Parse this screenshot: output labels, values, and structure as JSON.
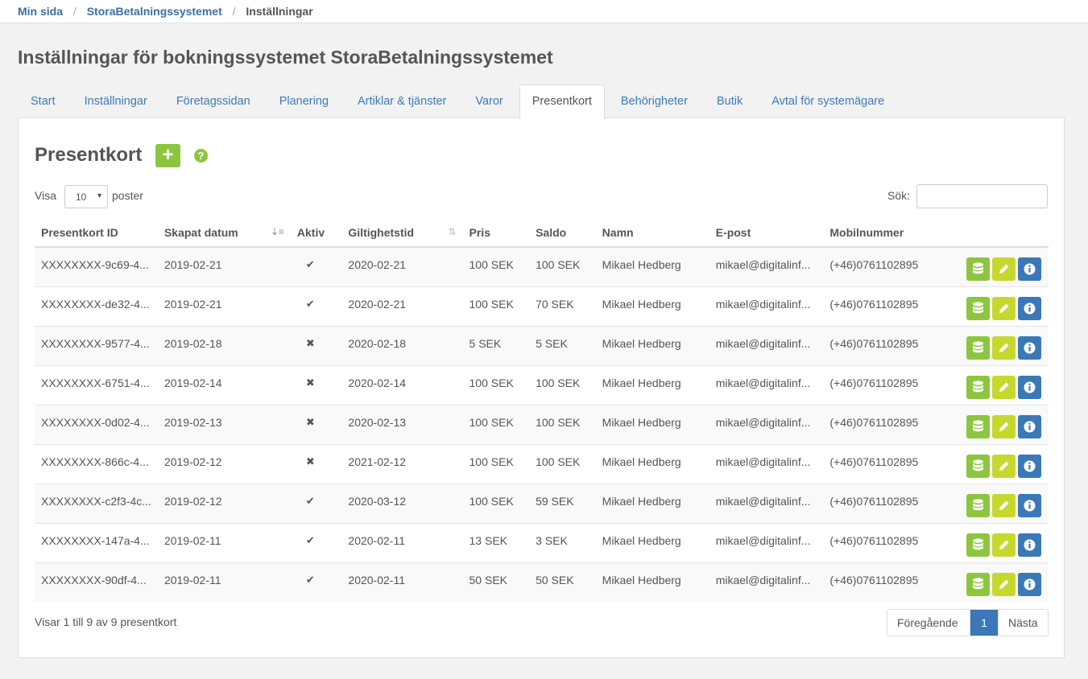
{
  "breadcrumb": {
    "items": [
      "Min sida",
      "StoraBetalningssystemet"
    ],
    "current": "Inställningar"
  },
  "page_title": "Inställningar för bokningssystemet StoraBetalningssystemet",
  "tabs": [
    {
      "label": "Start",
      "active": false
    },
    {
      "label": "Inställningar",
      "active": false
    },
    {
      "label": "Företagssidan",
      "active": false
    },
    {
      "label": "Planering",
      "active": false
    },
    {
      "label": "Artiklar & tjänster",
      "active": false
    },
    {
      "label": "Varor",
      "active": false
    },
    {
      "label": "Presentkort",
      "active": true
    },
    {
      "label": "Behörigheter",
      "active": false
    },
    {
      "label": "Butik",
      "active": false
    },
    {
      "label": "Avtal för systemägare",
      "active": false
    }
  ],
  "section": {
    "title": "Presentkort",
    "add_label": "+",
    "help_label": "?"
  },
  "controls": {
    "show_label": "Visa",
    "page_size": "10",
    "show_suffix": "poster",
    "search_label": "Sök:",
    "search_value": ""
  },
  "table": {
    "headers": [
      "Presentkort ID",
      "Skapat datum",
      "Aktiv",
      "Giltighetstid",
      "Pris",
      "Saldo",
      "Namn",
      "E-post",
      "Mobilnummer"
    ],
    "rows": [
      {
        "id": "XXXXXXXX-9c69-4...",
        "created": "2019-02-21",
        "active": true,
        "valid": "2020-02-21",
        "price": "100 SEK",
        "balance": "100 SEK",
        "name": "Mikael Hedberg",
        "email": "mikael@digitalinf...",
        "phone": "(+46)0761102895"
      },
      {
        "id": "XXXXXXXX-de32-4...",
        "created": "2019-02-21",
        "active": true,
        "valid": "2020-02-21",
        "price": "100 SEK",
        "balance": "70 SEK",
        "name": "Mikael Hedberg",
        "email": "mikael@digitalinf...",
        "phone": "(+46)0761102895"
      },
      {
        "id": "XXXXXXXX-9577-4...",
        "created": "2019-02-18",
        "active": false,
        "valid": "2020-02-18",
        "price": "5 SEK",
        "balance": "5 SEK",
        "name": "Mikael Hedberg",
        "email": "mikael@digitalinf...",
        "phone": "(+46)0761102895"
      },
      {
        "id": "XXXXXXXX-6751-4...",
        "created": "2019-02-14",
        "active": false,
        "valid": "2020-02-14",
        "price": "100 SEK",
        "balance": "100 SEK",
        "name": "Mikael Hedberg",
        "email": "mikael@digitalinf...",
        "phone": "(+46)0761102895"
      },
      {
        "id": "XXXXXXXX-0d02-4...",
        "created": "2019-02-13",
        "active": false,
        "valid": "2020-02-13",
        "price": "100 SEK",
        "balance": "100 SEK",
        "name": "Mikael Hedberg",
        "email": "mikael@digitalinf...",
        "phone": "(+46)0761102895"
      },
      {
        "id": "XXXXXXXX-866c-4...",
        "created": "2019-02-12",
        "active": false,
        "valid": "2021-02-12",
        "price": "100 SEK",
        "balance": "100 SEK",
        "name": "Mikael Hedberg",
        "email": "mikael@digitalinf...",
        "phone": "(+46)0761102895"
      },
      {
        "id": "XXXXXXXX-c2f3-4c...",
        "created": "2019-02-12",
        "active": true,
        "valid": "2020-03-12",
        "price": "100 SEK",
        "balance": "59 SEK",
        "name": "Mikael Hedberg",
        "email": "mikael@digitalinf...",
        "phone": "(+46)0761102895"
      },
      {
        "id": "XXXXXXXX-147a-4...",
        "created": "2019-02-11",
        "active": true,
        "valid": "2020-02-11",
        "price": "13 SEK",
        "balance": "3 SEK",
        "name": "Mikael Hedberg",
        "email": "mikael@digitalinf...",
        "phone": "(+46)0761102895"
      },
      {
        "id": "XXXXXXXX-90df-4...",
        "created": "2019-02-11",
        "active": true,
        "valid": "2020-02-11",
        "price": "50 SEK",
        "balance": "50 SEK",
        "name": "Mikael Hedberg",
        "email": "mikael@digitalinf...",
        "phone": "(+46)0761102895"
      }
    ],
    "row_action_icons": [
      "database-icon",
      "pencil-icon",
      "info-icon"
    ]
  },
  "footer": {
    "info": "Visar 1 till 9 av 9 presentkort",
    "prev_label": "Föregående",
    "current_page": "1",
    "next_label": "Nästa"
  },
  "colors": {
    "link": "#3a7bbf",
    "green": "#8cc63f",
    "yellow": "#c6d82d",
    "blue": "#3a78b8"
  }
}
